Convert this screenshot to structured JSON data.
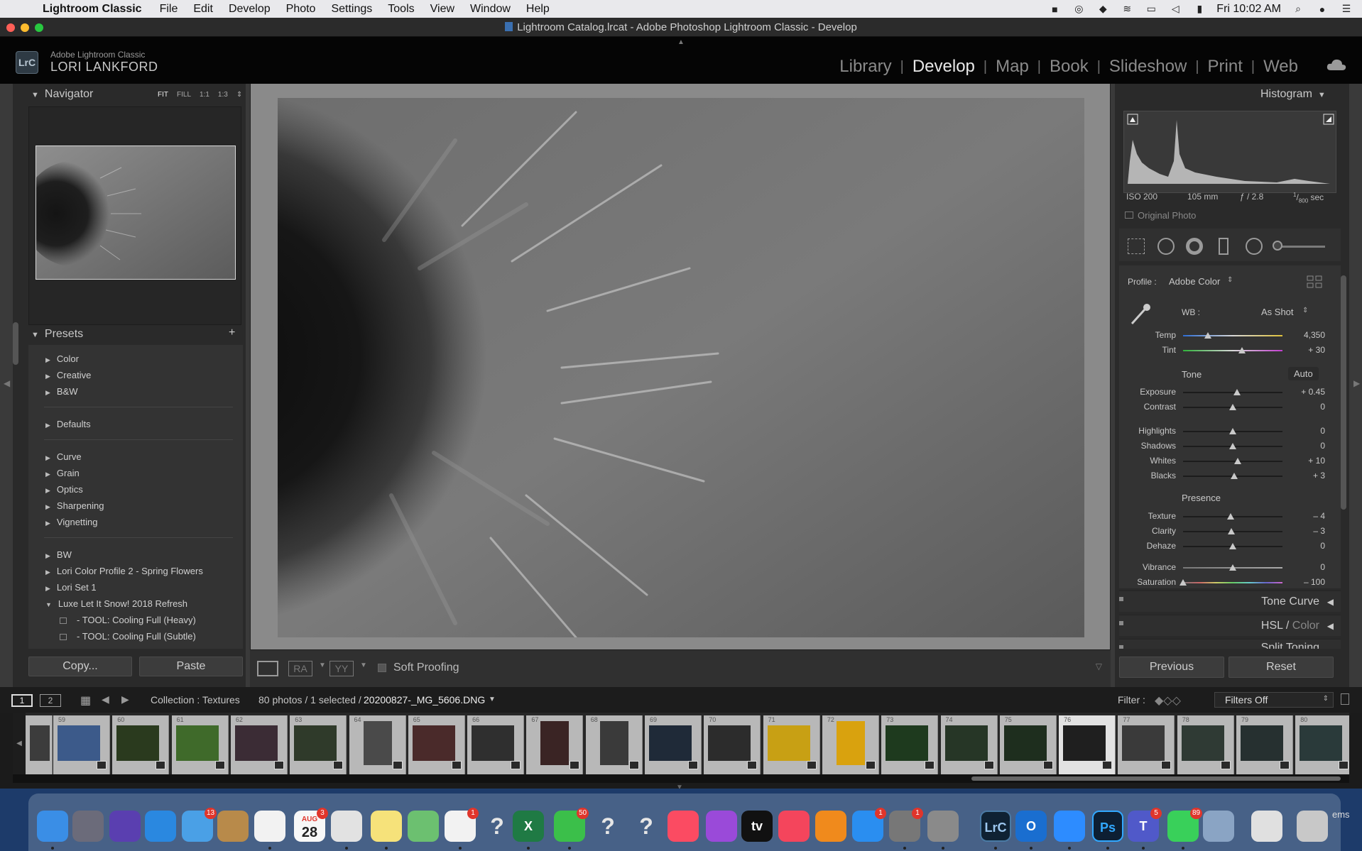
{
  "menubar": {
    "app_name": "Lightroom Classic",
    "items": [
      "File",
      "Edit",
      "Develop",
      "Photo",
      "Settings",
      "Tools",
      "View",
      "Window",
      "Help"
    ],
    "clock": "Fri 10:02 AM"
  },
  "window": {
    "title": "Lightroom Catalog.lrcat - Adobe Photoshop Lightroom Classic - Develop"
  },
  "identity": {
    "app_line": "Adobe Lightroom Classic",
    "user_line": "LORI LANKFORD",
    "badge": "LrC"
  },
  "modules": [
    "Library",
    "Develop",
    "Map",
    "Book",
    "Slideshow",
    "Print",
    "Web"
  ],
  "active_module": "Develop",
  "left_panel": {
    "navigator_title": "Navigator",
    "zoom_options": [
      "FIT",
      "FILL",
      "1:1",
      "1:3"
    ],
    "presets_title": "Presets",
    "preset_groups": [
      "Color",
      "Creative",
      "B&W",
      "Defaults",
      "Curve",
      "Grain",
      "Optics",
      "Sharpening",
      "Vignetting",
      "BW",
      "Lori Color Profile 2 - Spring Flowers",
      "Lori Set 1",
      "Luxe Let It Snow! 2018 Refresh"
    ],
    "preset_tools": [
      "- TOOL: Cooling Full (Heavy)",
      "- TOOL: Cooling Full (Subtle)"
    ],
    "copy_button": "Copy...",
    "paste_button": "Paste"
  },
  "toolbar": {
    "soft_proofing": "Soft Proofing"
  },
  "right_panel": {
    "histogram_title": "Histogram",
    "exif": {
      "iso": "ISO 200",
      "focal": "105 mm",
      "aperture": "ƒ / 2.8",
      "shutter_num": "1",
      "shutter_den": "800",
      "shutter_unit": "sec"
    },
    "original_photo": "Original Photo",
    "profile_label": "Profile :",
    "profile_value": "Adobe Color",
    "wb_label": "WB :",
    "wb_value": "As Shot",
    "tone_label": "Tone",
    "auto_label": "Auto",
    "presence_label": "Presence",
    "sliders": [
      {
        "name": "Temp",
        "value": "4,350",
        "pos": 0.25
      },
      {
        "name": "Tint",
        "value": "+ 30",
        "pos": 0.59
      },
      {
        "name": "Exposure",
        "value": "+ 0.45",
        "pos": 0.54
      },
      {
        "name": "Contrast",
        "value": "0",
        "pos": 0.5
      },
      {
        "name": "Highlights",
        "value": "0",
        "pos": 0.5
      },
      {
        "name": "Shadows",
        "value": "0",
        "pos": 0.5
      },
      {
        "name": "Whites",
        "value": "+ 10",
        "pos": 0.55
      },
      {
        "name": "Blacks",
        "value": "+ 3",
        "pos": 0.515
      },
      {
        "name": "Texture",
        "value": "– 4",
        "pos": 0.48
      },
      {
        "name": "Clarity",
        "value": "– 3",
        "pos": 0.485
      },
      {
        "name": "Dehaze",
        "value": "0",
        "pos": 0.5
      },
      {
        "name": "Vibrance",
        "value": "0",
        "pos": 0.5
      },
      {
        "name": "Saturation",
        "value": "– 100",
        "pos": 0.0
      }
    ],
    "tone_curve": "Tone Curve",
    "hsl": "HSL",
    "color": "Color",
    "split_toning": "Split Toning",
    "previous_button": "Previous",
    "reset_button": "Reset"
  },
  "filmstrip_bar": {
    "view1": "1",
    "view2": "2",
    "collection": "Collection : Textures",
    "count": "80 photos / 1 selected /",
    "filename": "20200827-_MG_5606.DNG",
    "filter_label": "Filter :",
    "filter_value": "Filters Off"
  },
  "filmstrip": {
    "numbers": [
      "59",
      "60",
      "61",
      "62",
      "63",
      "64",
      "65",
      "66",
      "67",
      "68",
      "69",
      "70",
      "71",
      "72",
      "73",
      "74",
      "75",
      "76",
      "77",
      "78",
      "79",
      "80"
    ],
    "selected": "76"
  },
  "dock": {
    "badges": {
      "mail": "13",
      "calendar": "3",
      "photos": "1",
      "facetime": "50",
      "appstore": "1",
      "sysprefs": "1",
      "teams": "5",
      "messages": "89"
    },
    "calendar_month": "AUG",
    "calendar_day": "28",
    "lrc": "LrC",
    "ps": "Ps",
    "tv": "tv",
    "partial_text": "ems"
  },
  "colors": {
    "accent": "#e8e8e8",
    "panel": "#2a2a2a",
    "canvas": "#8a8a8a"
  }
}
